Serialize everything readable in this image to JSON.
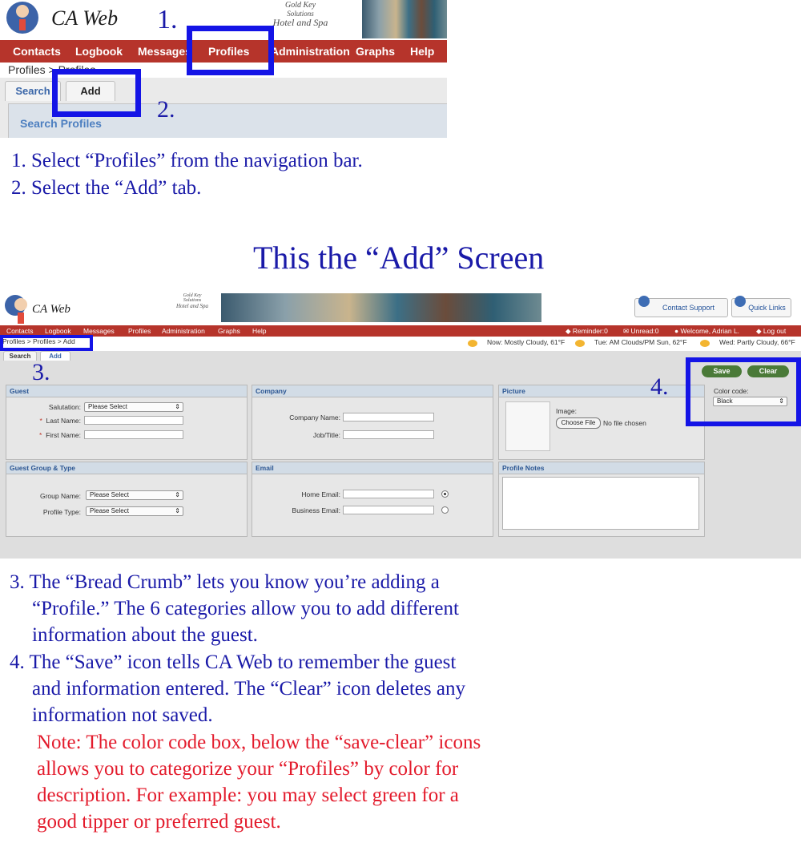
{
  "top_screenshot": {
    "app_name": "CA Web",
    "brand": [
      "Gold Key",
      "Solutions",
      "Hotel and Spa"
    ],
    "nav": [
      "Contacts",
      "Logbook",
      "Messages",
      "Profiles",
      "Administration",
      "Graphs",
      "Help"
    ],
    "breadcrumb": "Profiles > Profiles",
    "tabs": [
      "Search",
      "Add"
    ],
    "section_title": "Search Profiles",
    "markers": [
      "1.",
      "2."
    ]
  },
  "instructions_top": [
    "1. Select “Profiles” from the navigation bar.",
    "2. Select the “Add” tab."
  ],
  "headline": "This the “Add” Screen",
  "add_screen": {
    "app_name": "CA Web",
    "brand": [
      "Gold Key",
      "Solutions",
      "Hotel and Spa"
    ],
    "header_buttons": {
      "contact_support": "Contact Support",
      "quick_links": "Quick Links"
    },
    "nav": [
      "Contacts",
      "Logbook",
      "Messages",
      "Profiles",
      "Administration",
      "Graphs",
      "Help"
    ],
    "status": {
      "reminder": "Reminder:0",
      "unread": "Unread:0",
      "welcome": "Welcome, Adrian L.",
      "logout": "Log out"
    },
    "breadcrumb": "Profiles > Profiles > Add",
    "weather": [
      "Now: Mostly Cloudy, 61°F",
      "Tue: AM Clouds/PM Sun, 62°F",
      "Wed: Partly Cloudy, 66°F"
    ],
    "tabs": [
      "Search",
      "Add"
    ],
    "markers": [
      "3.",
      "4."
    ],
    "guest": {
      "title": "Guest",
      "salutation_label": "Salutation:",
      "salutation_value": "Please Select",
      "last_name_label": "Last Name:",
      "first_name_label": "First Name:",
      "required_mark": "*"
    },
    "company": {
      "title": "Company",
      "company_name_label": "Company Name:",
      "job_title_label": "Job/Title:"
    },
    "picture": {
      "title": "Picture",
      "image_label": "Image:",
      "choose_file": "Choose File",
      "no_file": "No file chosen"
    },
    "actions": {
      "save": "Save",
      "clear": "Clear",
      "color_code_label": "Color code:",
      "color_code_value": "Black"
    },
    "group": {
      "title": "Guest Group & Type",
      "group_name_label": "Group Name:",
      "group_name_value": "Please Select",
      "profile_type_label": "Profile Type:",
      "profile_type_value": "Please Select"
    },
    "email": {
      "title": "Email",
      "home_label": "Home Email:",
      "business_label": "Business Email:"
    },
    "notes": {
      "title": "Profile Notes"
    }
  },
  "instructions_bottom": [
    "3. The “Bread Crumb” lets you know you’re adding a",
    "“Profile.”  The 6 categories allow you to add different",
    "information about the guest.",
    "4. The “Save” icon tells CA Web to remember the guest",
    "and information entered.  The “Clear” icon deletes any",
    "information not saved."
  ],
  "note_lines": [
    "Note: The color code box, below the “save-clear” icons",
    "allows you to categorize your “Profiles” by color for",
    "description.  For example: you may select green for a",
    "good tipper or preferred guest."
  ],
  "colors": {
    "nav_red": "#b6342b",
    "highlight_blue": "#1414e6",
    "instruction_blue": "#1a1aa8",
    "note_red": "#e31b2c",
    "button_green": "#4a7a38"
  }
}
